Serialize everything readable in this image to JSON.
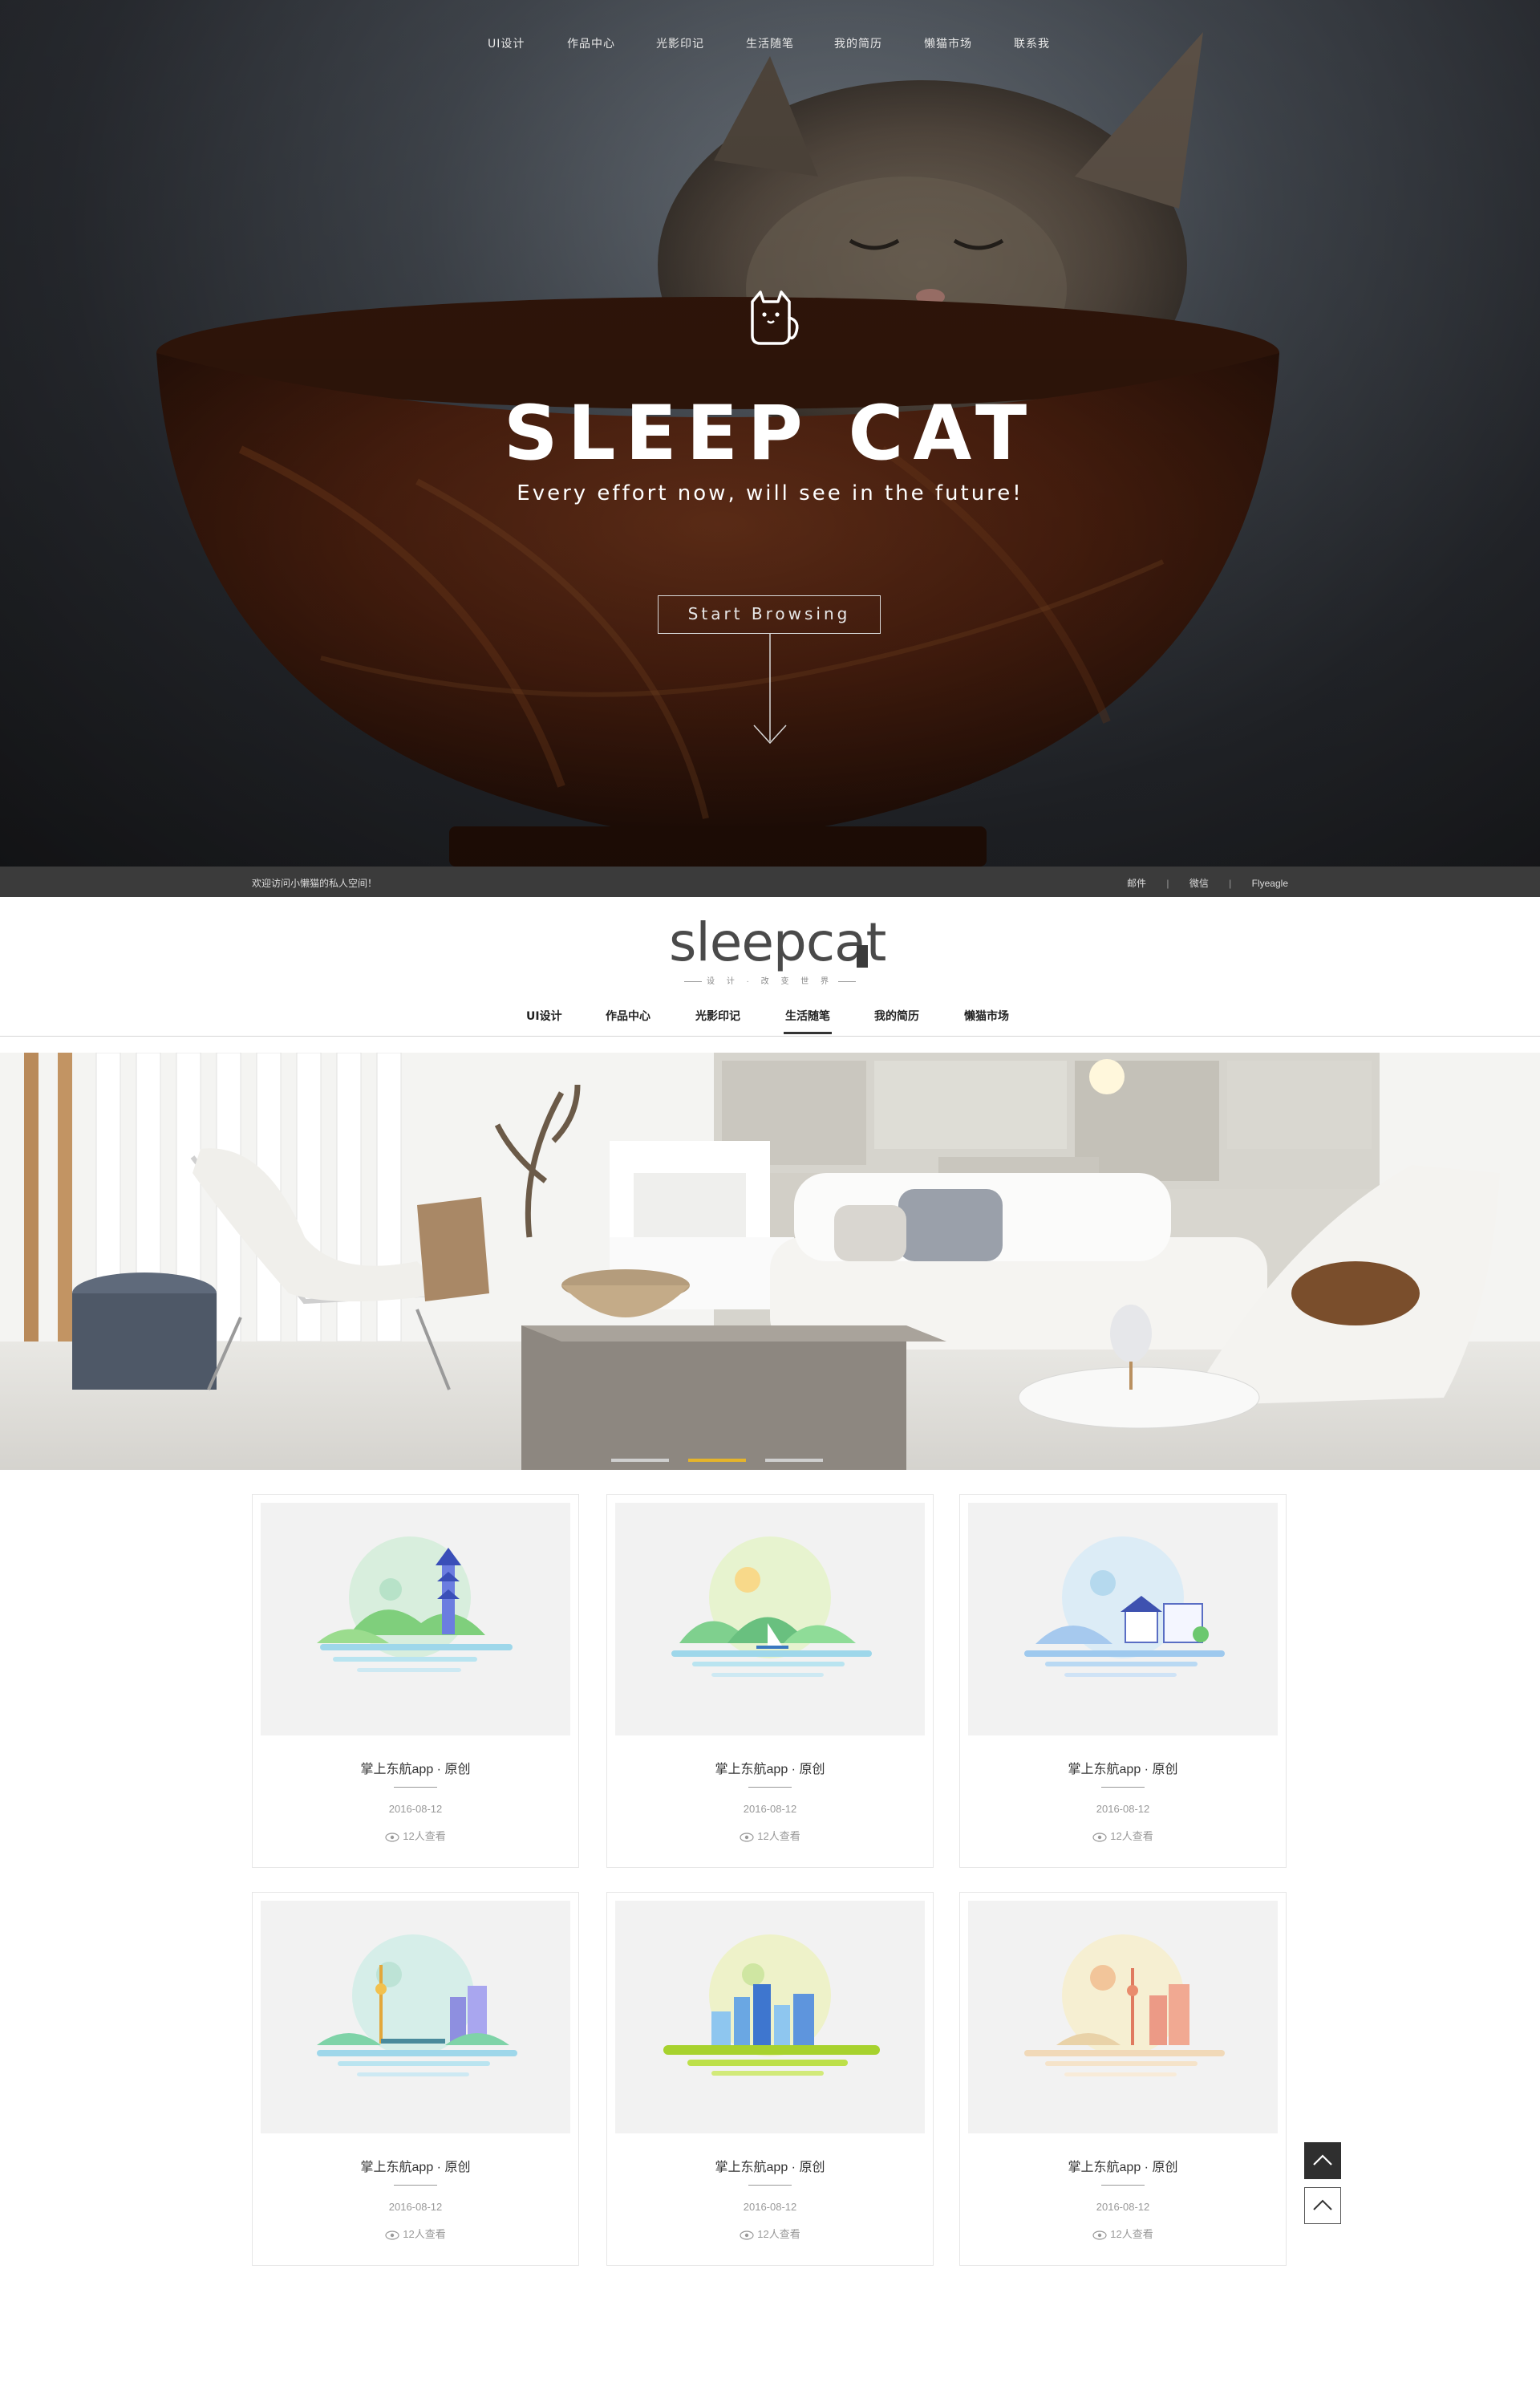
{
  "hero": {
    "nav": [
      {
        "label": "UI设计"
      },
      {
        "label": "作品中心"
      },
      {
        "label": "光影印记"
      },
      {
        "label": "生活随笔"
      },
      {
        "label": "我的简历"
      },
      {
        "label": "懒猫市场"
      },
      {
        "label": "联系我"
      }
    ],
    "title": "SLEEP CAT",
    "subtitle": "Every effort now, will see  in the future!",
    "button_label": "Start Browsing",
    "logo_icon": "cat-logo-icon"
  },
  "info_bar": {
    "welcome": "欢迎访问小懒猫的私人空间！",
    "links": [
      "邮件",
      "微信",
      "Flyeagle"
    ],
    "separator": "|"
  },
  "header": {
    "brand": "sleepcat",
    "tagline": "设 计 · 改 变 世 界",
    "nav": [
      {
        "label": "UI设计",
        "active": false
      },
      {
        "label": "作品中心",
        "active": false
      },
      {
        "label": "光影印记",
        "active": false
      },
      {
        "label": "生活随笔",
        "active": true
      },
      {
        "label": "我的简历",
        "active": false
      },
      {
        "label": "懒猫市场",
        "active": false
      }
    ]
  },
  "banner": {
    "slides": 3,
    "active_slide": 2,
    "accent_color": "#e5b42b"
  },
  "cards": [
    {
      "title": "掌上东航app · 原创",
      "date": "2016-08-12",
      "views": "12人查看",
      "theme": "pagoda"
    },
    {
      "title": "掌上东航app · 原创",
      "date": "2016-08-12",
      "views": "12人查看",
      "theme": "lake-boat"
    },
    {
      "title": "掌上东航app · 原创",
      "date": "2016-08-12",
      "views": "12人查看",
      "theme": "village"
    },
    {
      "title": "掌上东航app · 原创",
      "date": "2016-08-12",
      "views": "12人查看",
      "theme": "tower-bridge"
    },
    {
      "title": "掌上东航app · 原创",
      "date": "2016-08-12",
      "views": "12人查看",
      "theme": "city-green"
    },
    {
      "title": "掌上东航app · 原创",
      "date": "2016-08-12",
      "views": "12人查看",
      "theme": "city-warm"
    }
  ],
  "float_buttons": [
    {
      "icon": "chevron-up-icon",
      "style": "dark"
    },
    {
      "icon": "chevron-up-icon",
      "style": "light"
    }
  ]
}
